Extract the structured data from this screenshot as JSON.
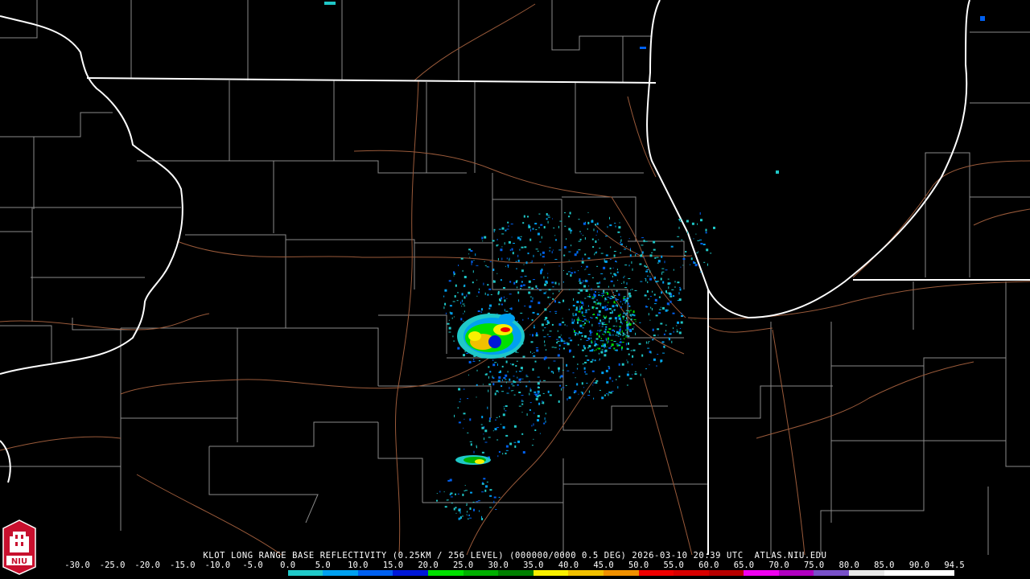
{
  "product_title": "KLOT LONG RANGE BASE REFLECTIVITY (0.25KM / 256 LEVEL) (000000/0000 0.5 DEG) 2026-03-10 20:39 UTC  ATLAS.NIU.EDU",
  "logo_text": "NIU",
  "legend": {
    "ticks": [
      "-30.0",
      "-25.0",
      "-20.0",
      "-15.0",
      "-10.0",
      "-5.0",
      "0.0",
      "5.0",
      "10.0",
      "15.0",
      "20.0",
      "25.0",
      "30.0",
      "35.0",
      "40.0",
      "45.0",
      "50.0",
      "55.0",
      "60.0",
      "65.0",
      "70.0",
      "75.0",
      "80.0",
      "85.0",
      "90.0",
      "94.5"
    ],
    "colors": [
      "#000000",
      "#000000",
      "#000000",
      "#000000",
      "#000000",
      "#000000",
      "#1fc8c8",
      "#00a0f0",
      "#0060f0",
      "#0018d8",
      "#00e000",
      "#00b000",
      "#008000",
      "#f8f000",
      "#f0c000",
      "#f09000",
      "#f00000",
      "#d80000",
      "#b80000",
      "#f000f0",
      "#b000c0",
      "#7850c8",
      "#e8e8e8",
      "#ffffff",
      "#ffffff"
    ]
  },
  "map_colors": {
    "state_border": "#ffffff",
    "county_border": "#8a8a8a",
    "highway": "#9a5a3a"
  }
}
